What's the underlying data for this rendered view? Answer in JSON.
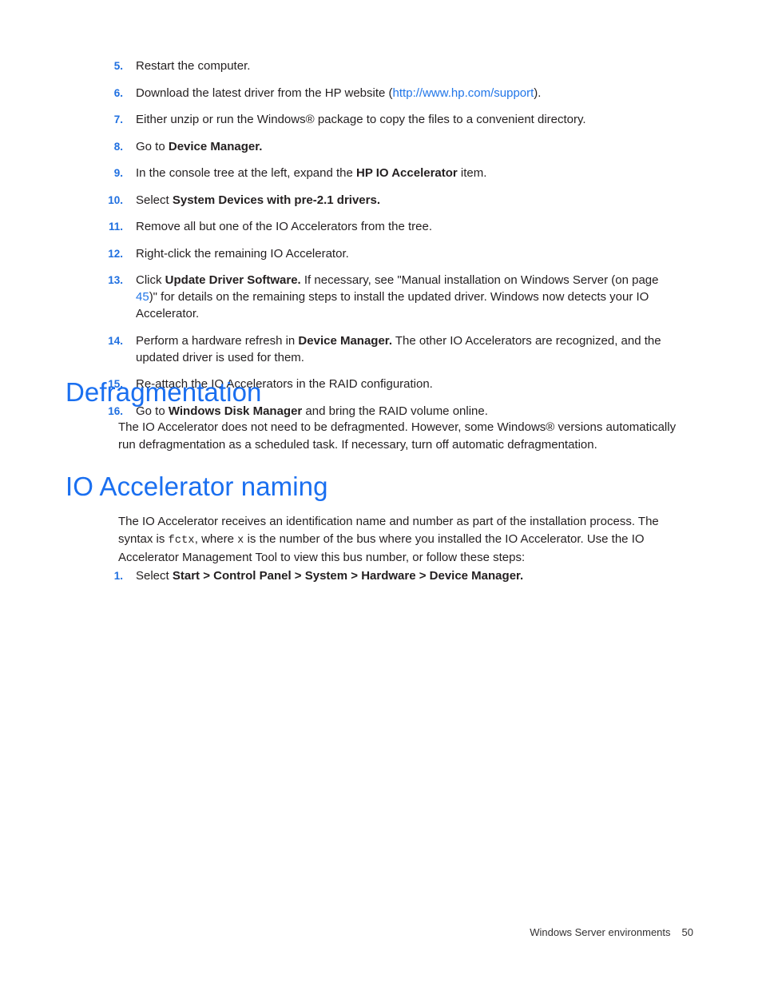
{
  "document": {
    "footer": {
      "chapter": "Windows Server environments",
      "page_number": "50"
    }
  },
  "colors": {
    "heading_blue": "#1a6ff0",
    "link_blue": "#2176e8",
    "list_number_blue": "#1f6fe0",
    "body_text": "#231f20"
  },
  "steps_continued": [
    {
      "number": "5.",
      "segments": [
        {
          "text": "Restart the computer.",
          "style": "normal"
        }
      ]
    },
    {
      "number": "6.",
      "segments": [
        {
          "text": "Download the latest driver from the HP website (",
          "style": "normal"
        },
        {
          "text": "http://www.hp.com/support",
          "style": "link"
        },
        {
          "text": ").",
          "style": "normal"
        }
      ]
    },
    {
      "number": "7.",
      "segments": [
        {
          "text": "Either unzip or run the Windows® package to copy the files to a convenient directory.",
          "style": "normal"
        }
      ]
    },
    {
      "number": "8.",
      "segments": [
        {
          "text": "Go to ",
          "style": "normal"
        },
        {
          "text": "Device Manager.",
          "style": "bold"
        }
      ]
    },
    {
      "number": "9.",
      "segments": [
        {
          "text": "In the console tree at the left, expand the ",
          "style": "normal"
        },
        {
          "text": "HP IO Accelerator",
          "style": "bold"
        },
        {
          "text": " item.",
          "style": "normal"
        }
      ]
    },
    {
      "number": "10.",
      "segments": [
        {
          "text": "Select ",
          "style": "normal"
        },
        {
          "text": "System Devices with pre-2.1 drivers.",
          "style": "bold"
        }
      ]
    },
    {
      "number": "11.",
      "segments": [
        {
          "text": "Remove all but one of the IO Accelerators from the tree.",
          "style": "normal"
        }
      ]
    },
    {
      "number": "12.",
      "segments": [
        {
          "text": "Right-click the remaining IO Accelerator.",
          "style": "normal"
        }
      ]
    },
    {
      "number": "13.",
      "segments": [
        {
          "text": "Click ",
          "style": "normal"
        },
        {
          "text": "Update Driver Software.",
          "style": "bold"
        },
        {
          "text": " If necessary, see \"Manual installation on Windows Server (on page ",
          "style": "normal"
        },
        {
          "text": "45",
          "style": "link"
        },
        {
          "text": ")\" for details on the remaining steps to install the updated driver. Windows now detects your IO Accelerator.",
          "style": "normal"
        }
      ]
    },
    {
      "number": "14.",
      "segments": [
        {
          "text": "Perform a hardware refresh in ",
          "style": "normal"
        },
        {
          "text": "Device Manager.",
          "style": "bold"
        },
        {
          "text": " The other IO Accelerators are recognized, and the updated driver is used for them.",
          "style": "normal"
        }
      ]
    },
    {
      "number": "15.",
      "segments": [
        {
          "text": "Re-attach the IO Accelerators in the RAID configuration.",
          "style": "normal"
        }
      ]
    },
    {
      "number": "16.",
      "segments": [
        {
          "text": "Go to ",
          "style": "normal"
        },
        {
          "text": "Windows Disk Manager",
          "style": "bold"
        },
        {
          "text": " and bring the RAID volume online.",
          "style": "normal"
        }
      ]
    }
  ],
  "sections": [
    {
      "id": "defragmentation",
      "heading": "Defragmentation",
      "paragraph": [
        {
          "text": "The IO Accelerator does not need to be defragmented. However, some Windows® versions automatically run defragmentation as a scheduled task. If necessary, turn off automatic defragmentation.",
          "style": "normal"
        }
      ]
    },
    {
      "id": "io-accelerator-naming",
      "heading": "IO Accelerator naming",
      "paragraph": [
        {
          "text": "The IO Accelerator receives an identification name and number as part of the installation process. The syntax is ",
          "style": "normal"
        },
        {
          "text": "fctx",
          "style": "mono"
        },
        {
          "text": ", where ",
          "style": "normal"
        },
        {
          "text": "x",
          "style": "mono"
        },
        {
          "text": " is the number of the bus where you installed the IO Accelerator. Use the IO Accelerator Management Tool to view this bus number, or follow these steps:",
          "style": "normal"
        }
      ]
    }
  ],
  "steps_naming": [
    {
      "number": "1.",
      "segments": [
        {
          "text": "Select ",
          "style": "normal"
        },
        {
          "text": "Start > Control Panel > System > Hardware > Device Manager.",
          "style": "bold"
        }
      ]
    }
  ]
}
